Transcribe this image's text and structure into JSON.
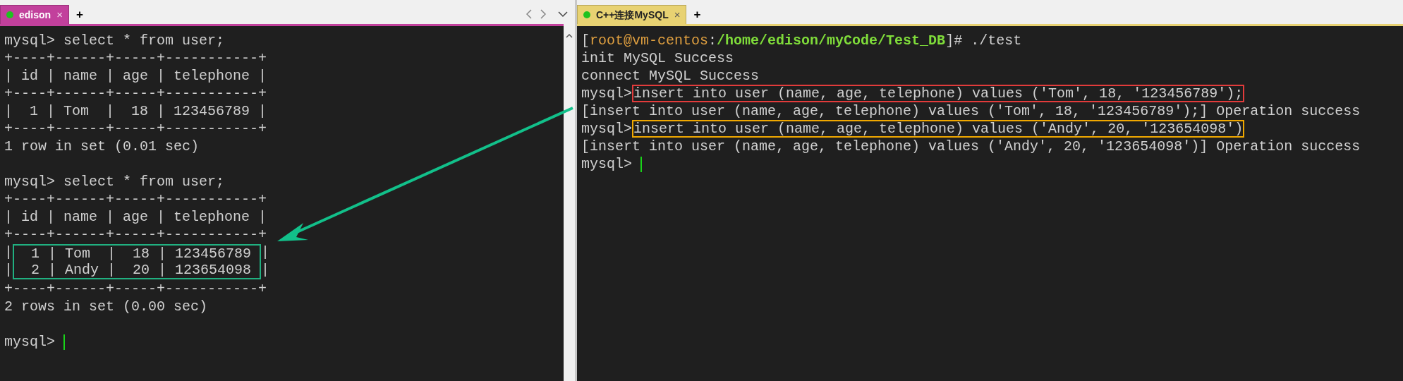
{
  "left_pane": {
    "tabs": [
      {
        "label": "edison",
        "close": "×",
        "selected": true,
        "color": "#c2409c"
      }
    ],
    "new_tab": "+",
    "lines": [
      {
        "kind": "text",
        "text": "mysql> select * from user;"
      },
      {
        "kind": "text",
        "text": "+----+------+-----+-----------+"
      },
      {
        "kind": "text",
        "text": "| id | name | age | telephone |"
      },
      {
        "kind": "text",
        "text": "+----+------+-----+-----------+"
      },
      {
        "kind": "text",
        "text": "|  1 | Tom  |  18 | 123456789 |"
      },
      {
        "kind": "text",
        "text": "+----+------+-----+-----------+"
      },
      {
        "kind": "text",
        "text": "1 row in set (0.01 sec)"
      },
      {
        "kind": "blank"
      },
      {
        "kind": "text",
        "text": "mysql> select * from user;"
      },
      {
        "kind": "text",
        "text": "+----+------+-----+-----------+"
      },
      {
        "kind": "text",
        "text": "| id | name | age | telephone |"
      },
      {
        "kind": "text",
        "text": "+----+------+-----+-----------+"
      },
      {
        "kind": "boxed",
        "color": "#20b080",
        "rows": [
          {
            "prefix": "|",
            "inner": "  1 | Tom  |  18 | 123456789 ",
            "suffix": "|"
          },
          {
            "prefix": "|",
            "inner": "  2 | Andy |  20 | 123654098 ",
            "suffix": "|"
          }
        ]
      },
      {
        "kind": "text",
        "text": "+----+------+-----+-----------+"
      },
      {
        "kind": "text",
        "text": "2 rows in set (0.00 sec)"
      },
      {
        "kind": "blank"
      },
      {
        "kind": "prompt",
        "prompt": "mysql> ",
        "cursor": true
      }
    ]
  },
  "right_pane": {
    "tabs": [
      {
        "label": "C++连接MySQL",
        "close": "×",
        "selected": true,
        "color": "#e8d272"
      }
    ],
    "new_tab": "+",
    "lines": [
      {
        "kind": "shell",
        "segments": [
          {
            "text": "[",
            "color": "#d0d0d0"
          },
          {
            "text": "root@vm-centos",
            "color": "#e0a040"
          },
          {
            "text": ":",
            "color": "#d0d0d0"
          },
          {
            "text": "/home/edison/myCode/Test_DB",
            "color": "#7fdc3a"
          },
          {
            "text": "]# ./test",
            "color": "#d0d0d0"
          }
        ]
      },
      {
        "kind": "text",
        "text": "init MySQL Success"
      },
      {
        "kind": "text",
        "text": "connect MySQL Success"
      },
      {
        "kind": "prompt",
        "prompt": "mysql>",
        "command": "insert into user (name, age, telephone) values ('Tom', 18, '123456789');",
        "color": "#e23b3b"
      },
      {
        "kind": "text",
        "text": "[insert into user (name, age, telephone) values ('Tom', 18, '123456789');] Operation success"
      },
      {
        "kind": "prompt",
        "prompt": "mysql>",
        "command": "insert into user (name, age, telephone) values ('Andy', 20, '123654098')",
        "color": "#f0a800"
      },
      {
        "kind": "text",
        "text": "[insert into user (name, age, telephone) values ('Andy', 20, '123654098')] Operation success"
      },
      {
        "kind": "prompt",
        "prompt": "mysql> ",
        "cursor": true
      }
    ]
  }
}
